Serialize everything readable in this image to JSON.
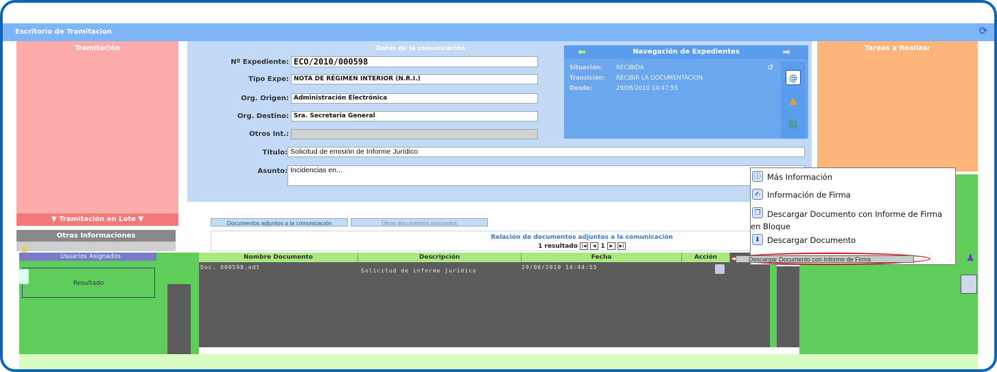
{
  "window": {
    "title": "Escritorio de Tramitacion"
  },
  "panels": {
    "left_title": "Tramitación",
    "lote": "▼ Tramitación en Lote ▼",
    "otras": "Otras Informaciones",
    "right_title": "Tareas a Realizar",
    "usuarios": "Usuarios Asignados",
    "resultado": "Resultado"
  },
  "form": {
    "section_title": "Datos de la comunicación",
    "expediente": {
      "label": "Nº Expediente:",
      "value": "ECO/2010/000598"
    },
    "tipo": {
      "label": "Tipo Expe:",
      "value": "NOTA DE RÉGIMEN INTERIOR (N.R.I.)"
    },
    "origen": {
      "label": "Org. Origen:",
      "value": "Administración Electrónica"
    },
    "destino": {
      "label": "Org. Destino:",
      "value": "Sra. Secretaria General"
    },
    "otros": {
      "label": "Otros Int.:",
      "value": ""
    },
    "titulo": {
      "label": "Título:",
      "value": "Solicitud de emisión de Informe Jurídico"
    },
    "asunto": {
      "label": "Asunto:",
      "value": "Incidencias en..."
    }
  },
  "nav": {
    "title": "Navegación de Expedientes",
    "situacion": {
      "label": "Situación:",
      "value": "RECIBIDA"
    },
    "transicion": {
      "label": "Transición:",
      "value": "RECIBIR LA DOCUMENTACION"
    },
    "desde": {
      "label": "Desde:",
      "value": "29/06/2010 14:47:55"
    }
  },
  "tabs": {
    "adjuntos": "Documentos adjuntos a la comunicación",
    "asociados": "Otros documentos asociados"
  },
  "relacion": {
    "title": "Relación de documentos adjuntos a la comunicación",
    "count": "1 resultado",
    "page": "1"
  },
  "table": {
    "headers": [
      "Nombre Documento",
      "Descripción",
      "Fecha",
      "Acción"
    ],
    "row": [
      "Doc. 000598.odt",
      "Solicitud de informe jurídico",
      "29/06/2010 14:44:55"
    ]
  },
  "context_menu": {
    "items": [
      "Más Información",
      "Información de Firma",
      "Descargar Documento con Informe de Firma en Bloque",
      "Descargar Documento"
    ],
    "highlighted": "Descargar Documento con Informe de Firma"
  },
  "colors": {
    "accent": "#0a66b8",
    "titlebar": "#7eb4f8",
    "highlight_ring": "#d21919"
  }
}
